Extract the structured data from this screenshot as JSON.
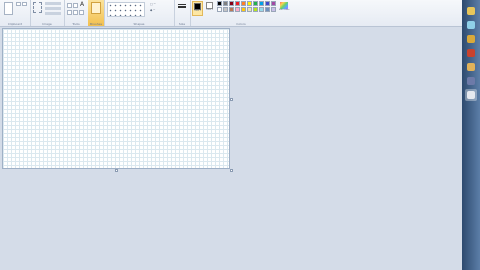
{
  "ribbon": {
    "groups": {
      "clipboard": "Clipboard",
      "image": "Image",
      "tools": "Tools",
      "brushes": "Brushes",
      "shapes": "Shapes",
      "size": "Size",
      "colors": "Colors"
    },
    "color1_label": "Color 1",
    "color2_label": "Color 2",
    "edit_colors_label": "Edit colors"
  },
  "palette": [
    "#000000",
    "#7f7f7f",
    "#880015",
    "#ed1c24",
    "#ff7f27",
    "#fff200",
    "#22b14c",
    "#00a2e8",
    "#3f48cc",
    "#a349a4",
    "#ffffff",
    "#c3c3c3",
    "#b97a57",
    "#ffaec9",
    "#ffc90e",
    "#efe4b0",
    "#b5e61d",
    "#99d9ea",
    "#7092be",
    "#c8bfe7"
  ],
  "color1": "#000000",
  "color2": "#ffffff",
  "taskbar": {
    "icons": [
      {
        "name": "folder-icon",
        "color": "#e8c65a"
      },
      {
        "name": "recycle-icon",
        "color": "#8fd0e8"
      },
      {
        "name": "chrome-icon",
        "color": "#d9a93a"
      },
      {
        "name": "media-icon",
        "color": "#c8422e"
      },
      {
        "name": "user-icon",
        "color": "#e0b25a"
      },
      {
        "name": "games-icon",
        "color": "#6d7aa8"
      },
      {
        "name": "paint-icon",
        "color": "#e6e9ef"
      }
    ]
  }
}
